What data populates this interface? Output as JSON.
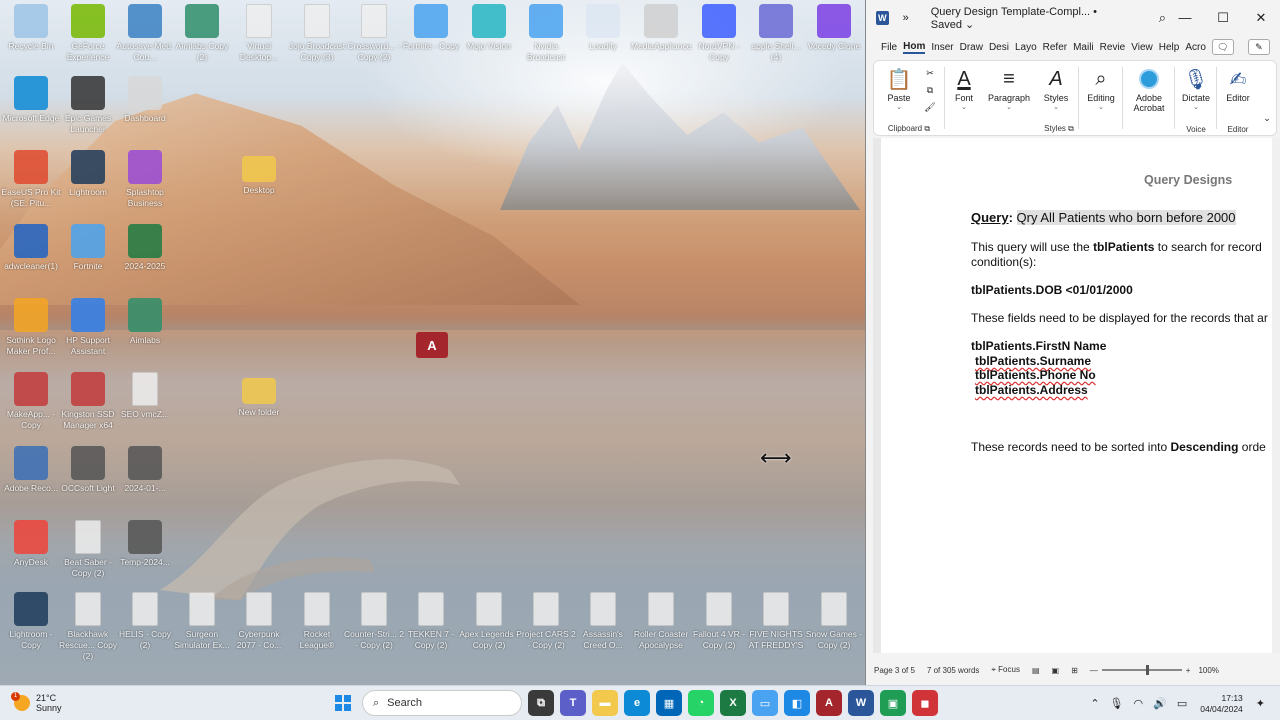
{
  "desktop": {
    "icons": [
      {
        "label": "Recycle Bin",
        "color": "#9ec5e8"
      },
      {
        "label": "GeForce Experience",
        "color": "#76b900"
      },
      {
        "label": "Autosave Med. Cou...",
        "color": "#3b82c4"
      },
      {
        "label": "Aimlabs Copy (2)",
        "color": "#2f8f6b"
      },
      {
        "label": "Virtual Desktop...",
        "color": "#eeeeee"
      },
      {
        "label": "Jojo Broadcast Copy (3)",
        "color": "#eeeeee"
      },
      {
        "label": "Crossword... - Copy (2)",
        "color": "#eeeeee"
      },
      {
        "label": "Fortnite - Copy",
        "color": "#4aa3f0"
      },
      {
        "label": "Mojo Vision",
        "color": "#26b5c4"
      },
      {
        "label": "Nvidia Broadcast",
        "color": "#4aa3f0"
      },
      {
        "label": "Loadify",
        "color": "#dde7f3"
      },
      {
        "label": "MediaAppliance",
        "color": "#d0d0d0"
      },
      {
        "label": "NordVPN - Copy",
        "color": "#3e5fff"
      },
      {
        "label": "apple Shell... (4)",
        "color": "#6b6bd6"
      },
      {
        "label": "Vocedy Clone",
        "color": "#7b3fe4"
      },
      {
        "label": "Microsoft Edge",
        "color": "#0c8ad6"
      },
      {
        "label": "Epic Games Launcher",
        "color": "#333333"
      },
      {
        "label": "Dashboard",
        "color": "#d8d8d8"
      },
      {
        "label": "EaseUS Pro Kit (SE. Pitu...",
        "color": "#e04a2f"
      },
      {
        "label": "Lightroom",
        "color": "#1d3b5a"
      },
      {
        "label": "Splashtop Business",
        "color": "#9a4bd6"
      },
      {
        "label": "Desktop",
        "color": "#f2c94c"
      },
      {
        "label": "adwcleaner(1)",
        "color": "#1e63c4"
      },
      {
        "label": "Fortnite",
        "color": "#4aa3f0"
      },
      {
        "label": "2024-2025",
        "color": "#1d7a43"
      },
      {
        "label": "Sothink Logo Maker Prof...",
        "color": "#f5a623"
      },
      {
        "label": "HP Support Assistant",
        "color": "#2f80ed"
      },
      {
        "label": "Aimlabs",
        "color": "#2f8f6b"
      },
      {
        "label": "MakeApp... - Copy",
        "color": "#c23b3b"
      },
      {
        "label": "Kingston SSD Manager x64",
        "color": "#c23b3b"
      },
      {
        "label": "SEO vmcZ...",
        "color": "#eeeeee"
      },
      {
        "label": "New folder",
        "color": "#f2c94c"
      },
      {
        "label": "Adobe Reco...",
        "color": "#3b6fb6"
      },
      {
        "label": "OCCsoft Light",
        "color": "#555555"
      },
      {
        "label": "2024-01-...",
        "color": "#555555"
      },
      {
        "label": "AnyDesk",
        "color": "#ef443b"
      },
      {
        "label": "Beat Saber - Copy (2)",
        "color": "#eeeeee"
      },
      {
        "label": "Temp-2024...",
        "color": "#555555"
      },
      {
        "label": "Lightroom - Copy",
        "color": "#1d3b5a"
      },
      {
        "label": "Blackhawk Rescue... Copy (2)",
        "color": "#eeeeee"
      },
      {
        "label": "HELIS - Copy (2)",
        "color": "#eeeeee"
      },
      {
        "label": "Surgeon Simulator Ex...",
        "color": "#eeeeee"
      },
      {
        "label": "Cyberpunk 2077 - Co...",
        "color": "#eeeeee"
      },
      {
        "label": "Rocket League®",
        "color": "#eeeeee"
      },
      {
        "label": "Counter-Stri... 2 - Copy (2)",
        "color": "#eeeeee"
      },
      {
        "label": "TEKKEN 7 - Copy (2)",
        "color": "#eeeeee"
      },
      {
        "label": "Apex Legends - Copy (2)",
        "color": "#eeeeee"
      },
      {
        "label": "Project CARS 2 - Copy (2)",
        "color": "#eeeeee"
      },
      {
        "label": "Assassin's Creed O...",
        "color": "#eeeeee"
      },
      {
        "label": "Roller Coaster Apocalypse",
        "color": "#eeeeee"
      },
      {
        "label": "Fallout 4 VR - Copy (2)",
        "color": "#eeeeee"
      },
      {
        "label": "FIVE NIGHTS AT FREDDY'S",
        "color": "#eeeeee"
      },
      {
        "label": "Snow Games - Copy (2)",
        "color": "#eeeeee"
      }
    ],
    "access_icon_letter": "A"
  },
  "word": {
    "app_letter": "W",
    "title": "Query Design Template-Compl...",
    "saved_status": "Saved",
    "menu": [
      "File",
      "Hom",
      "Inser",
      "Draw",
      "Desi",
      "Layo",
      "Refer",
      "Maili",
      "Revie",
      "View",
      "Help",
      "Acro"
    ],
    "ribbon": {
      "paste": "Paste",
      "clipboard_group": "Clipboard",
      "font": "Font",
      "paragraph": "Paragraph",
      "styles": "Styles",
      "styles_group": "Styles",
      "editing": "Editing",
      "adobe": "Adobe Acrobat",
      "dictate": "Dictate",
      "voice_group": "Voice",
      "editor": "Editor",
      "editor_group": "Editor"
    },
    "document": {
      "heading": "Query Designs",
      "query_label": "Query",
      "query_name": "Qry All Patients who born before 2000",
      "line1_pre": "This query will use the ",
      "line1_table": "tblPatients",
      "line1_post": " to search for record",
      "line2": "condition(s):",
      "condition": "tblPatients.DOB <01/01/2000",
      "fields_intro": "These fields need to be displayed for the records that ar",
      "fields": [
        "tblPatients.FirstN Name",
        "tblPatients.Surname",
        "tblPatients.Phone No",
        "tblPatients.Address"
      ],
      "sort_pre": "These records need to be sorted into ",
      "sort_bold": "Descending",
      "sort_post": " orde"
    },
    "status": {
      "page": "Page 3 of 5",
      "words": "7 of 305 words",
      "focus": "Focus",
      "zoom": "100%"
    }
  },
  "taskbar": {
    "temperature": "21°C",
    "weather": "Sunny",
    "weather_badge": "1",
    "search_placeholder": "Search",
    "time": "17:13",
    "date": "04/04/2024"
  }
}
